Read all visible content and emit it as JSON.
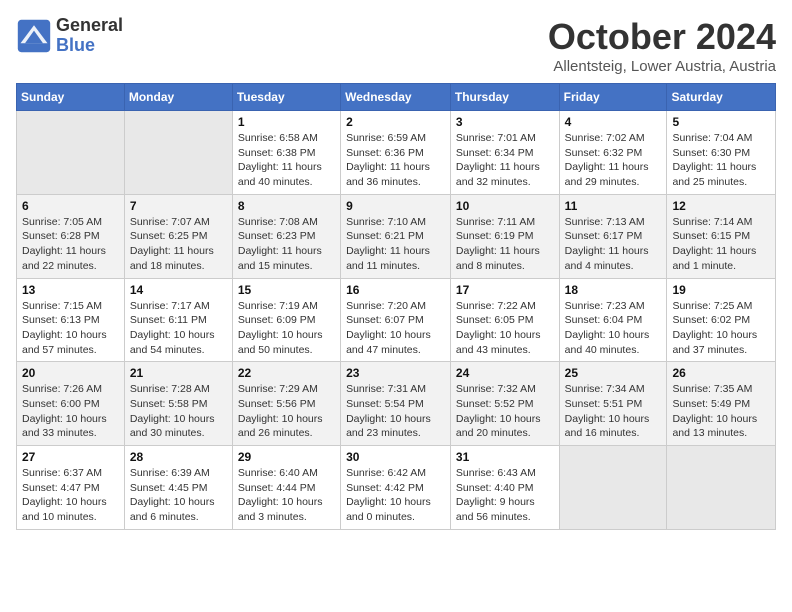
{
  "header": {
    "logo_line1": "General",
    "logo_line2": "Blue",
    "month": "October 2024",
    "location": "Allentsteig, Lower Austria, Austria"
  },
  "weekdays": [
    "Sunday",
    "Monday",
    "Tuesday",
    "Wednesday",
    "Thursday",
    "Friday",
    "Saturday"
  ],
  "weeks": [
    [
      {
        "day": "",
        "info": ""
      },
      {
        "day": "",
        "info": ""
      },
      {
        "day": "1",
        "info": "Sunrise: 6:58 AM\nSunset: 6:38 PM\nDaylight: 11 hours and 40 minutes."
      },
      {
        "day": "2",
        "info": "Sunrise: 6:59 AM\nSunset: 6:36 PM\nDaylight: 11 hours and 36 minutes."
      },
      {
        "day": "3",
        "info": "Sunrise: 7:01 AM\nSunset: 6:34 PM\nDaylight: 11 hours and 32 minutes."
      },
      {
        "day": "4",
        "info": "Sunrise: 7:02 AM\nSunset: 6:32 PM\nDaylight: 11 hours and 29 minutes."
      },
      {
        "day": "5",
        "info": "Sunrise: 7:04 AM\nSunset: 6:30 PM\nDaylight: 11 hours and 25 minutes."
      }
    ],
    [
      {
        "day": "6",
        "info": "Sunrise: 7:05 AM\nSunset: 6:28 PM\nDaylight: 11 hours and 22 minutes."
      },
      {
        "day": "7",
        "info": "Sunrise: 7:07 AM\nSunset: 6:25 PM\nDaylight: 11 hours and 18 minutes."
      },
      {
        "day": "8",
        "info": "Sunrise: 7:08 AM\nSunset: 6:23 PM\nDaylight: 11 hours and 15 minutes."
      },
      {
        "day": "9",
        "info": "Sunrise: 7:10 AM\nSunset: 6:21 PM\nDaylight: 11 hours and 11 minutes."
      },
      {
        "day": "10",
        "info": "Sunrise: 7:11 AM\nSunset: 6:19 PM\nDaylight: 11 hours and 8 minutes."
      },
      {
        "day": "11",
        "info": "Sunrise: 7:13 AM\nSunset: 6:17 PM\nDaylight: 11 hours and 4 minutes."
      },
      {
        "day": "12",
        "info": "Sunrise: 7:14 AM\nSunset: 6:15 PM\nDaylight: 11 hours and 1 minute."
      }
    ],
    [
      {
        "day": "13",
        "info": "Sunrise: 7:15 AM\nSunset: 6:13 PM\nDaylight: 10 hours and 57 minutes."
      },
      {
        "day": "14",
        "info": "Sunrise: 7:17 AM\nSunset: 6:11 PM\nDaylight: 10 hours and 54 minutes."
      },
      {
        "day": "15",
        "info": "Sunrise: 7:19 AM\nSunset: 6:09 PM\nDaylight: 10 hours and 50 minutes."
      },
      {
        "day": "16",
        "info": "Sunrise: 7:20 AM\nSunset: 6:07 PM\nDaylight: 10 hours and 47 minutes."
      },
      {
        "day": "17",
        "info": "Sunrise: 7:22 AM\nSunset: 6:05 PM\nDaylight: 10 hours and 43 minutes."
      },
      {
        "day": "18",
        "info": "Sunrise: 7:23 AM\nSunset: 6:04 PM\nDaylight: 10 hours and 40 minutes."
      },
      {
        "day": "19",
        "info": "Sunrise: 7:25 AM\nSunset: 6:02 PM\nDaylight: 10 hours and 37 minutes."
      }
    ],
    [
      {
        "day": "20",
        "info": "Sunrise: 7:26 AM\nSunset: 6:00 PM\nDaylight: 10 hours and 33 minutes."
      },
      {
        "day": "21",
        "info": "Sunrise: 7:28 AM\nSunset: 5:58 PM\nDaylight: 10 hours and 30 minutes."
      },
      {
        "day": "22",
        "info": "Sunrise: 7:29 AM\nSunset: 5:56 PM\nDaylight: 10 hours and 26 minutes."
      },
      {
        "day": "23",
        "info": "Sunrise: 7:31 AM\nSunset: 5:54 PM\nDaylight: 10 hours and 23 minutes."
      },
      {
        "day": "24",
        "info": "Sunrise: 7:32 AM\nSunset: 5:52 PM\nDaylight: 10 hours and 20 minutes."
      },
      {
        "day": "25",
        "info": "Sunrise: 7:34 AM\nSunset: 5:51 PM\nDaylight: 10 hours and 16 minutes."
      },
      {
        "day": "26",
        "info": "Sunrise: 7:35 AM\nSunset: 5:49 PM\nDaylight: 10 hours and 13 minutes."
      }
    ],
    [
      {
        "day": "27",
        "info": "Sunrise: 6:37 AM\nSunset: 4:47 PM\nDaylight: 10 hours and 10 minutes."
      },
      {
        "day": "28",
        "info": "Sunrise: 6:39 AM\nSunset: 4:45 PM\nDaylight: 10 hours and 6 minutes."
      },
      {
        "day": "29",
        "info": "Sunrise: 6:40 AM\nSunset: 4:44 PM\nDaylight: 10 hours and 3 minutes."
      },
      {
        "day": "30",
        "info": "Sunrise: 6:42 AM\nSunset: 4:42 PM\nDaylight: 10 hours and 0 minutes."
      },
      {
        "day": "31",
        "info": "Sunrise: 6:43 AM\nSunset: 4:40 PM\nDaylight: 9 hours and 56 minutes."
      },
      {
        "day": "",
        "info": ""
      },
      {
        "day": "",
        "info": ""
      }
    ]
  ]
}
